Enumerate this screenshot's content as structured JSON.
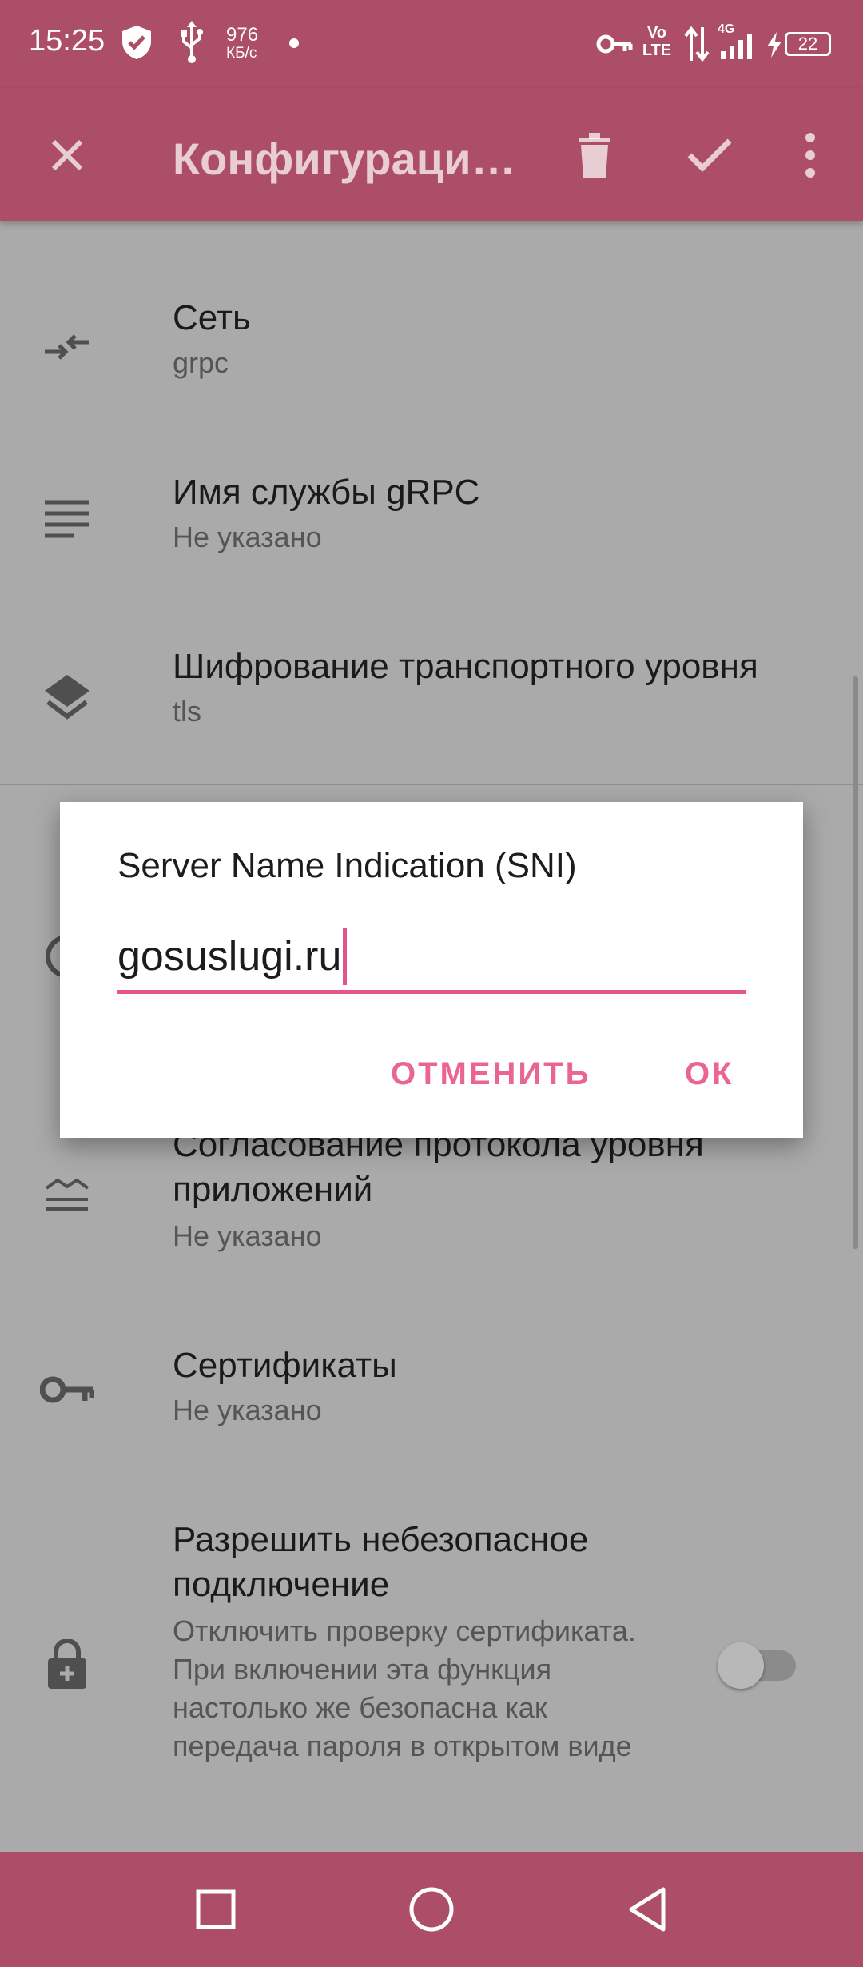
{
  "statusbar": {
    "time": "15:25",
    "speed_value": "976",
    "speed_unit": "КБ/с",
    "network": "4G",
    "volte": "Vo LTE",
    "battery": "22"
  },
  "appbar": {
    "title": "Конфигураци…",
    "icons": [
      "close-icon",
      "delete-icon",
      "check-icon",
      "more-vert-icon"
    ]
  },
  "settings": [
    {
      "icon": "compare-arrows-icon",
      "title": "Сеть",
      "subtitle": "grpc"
    },
    {
      "icon": "notes-icon",
      "title": "Имя службы gRPC",
      "subtitle": "Не указано"
    },
    {
      "icon": "layers-icon",
      "title": "Шифрование транспортного уровня",
      "subtitle": "tls"
    },
    {
      "icon": "alpn-icon",
      "title": "Согласование протокола уровня приложений",
      "subtitle": "Не указано"
    },
    {
      "icon": "key-icon",
      "title": "Сертификаты",
      "subtitle": "Не указано"
    },
    {
      "icon": "lock-add-icon",
      "title": "Разрешить небезопасное подключение",
      "subtitle": "Отключить проверку сертификата. При включении эта функция настолько же безопасна как передача пароля в открытом виде",
      "toggle_on": false
    }
  ],
  "dialog": {
    "title": "Server Name Indication (SNI)",
    "value": "gosuslugi.ru",
    "cancel": "ОТМЕНИТЬ",
    "ok": "ОК"
  },
  "navbar": {
    "icons": [
      "recents-icon",
      "home-icon",
      "back-icon"
    ]
  },
  "colors": {
    "bar": "#ac4e67",
    "accent": "#e5548a",
    "scrim": "#aaaaaa"
  }
}
